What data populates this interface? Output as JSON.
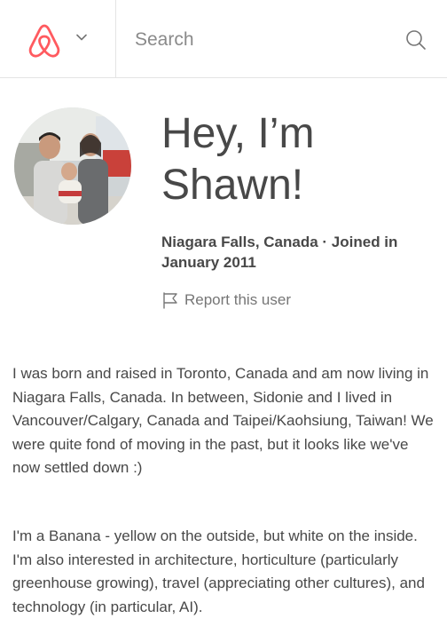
{
  "header": {
    "logo_icon": "airbnb-logo-icon",
    "menu_icon": "chevron-down-icon",
    "search": {
      "placeholder": "Search",
      "icon": "search-icon"
    },
    "accent_color": "#ff5a5f"
  },
  "profile": {
    "greeting": "Hey, I’m Shawn!",
    "location_joined": "Niagara Falls, Canada · Joined in January 2011",
    "report_label": "Report this user",
    "report_icon": "flag-icon"
  },
  "bio": {
    "paragraph_1": "I was born and raised in Toronto, Canada and am now living in Niagara Falls, Canada. In between, Sidonie and I lived in Vancouver/Calgary, Canada and Taipei/Kaohsiung, Taiwan! We were quite fond of moving in the past, but it looks like we've now settled down :)",
    "paragraph_2": "I'm a Banana - yellow on the outside, but white on the inside. I'm also interested in architecture, horticulture (particularly greenhouse growing), travel (appreciating other cultures), and technology (in particular, AI)."
  }
}
